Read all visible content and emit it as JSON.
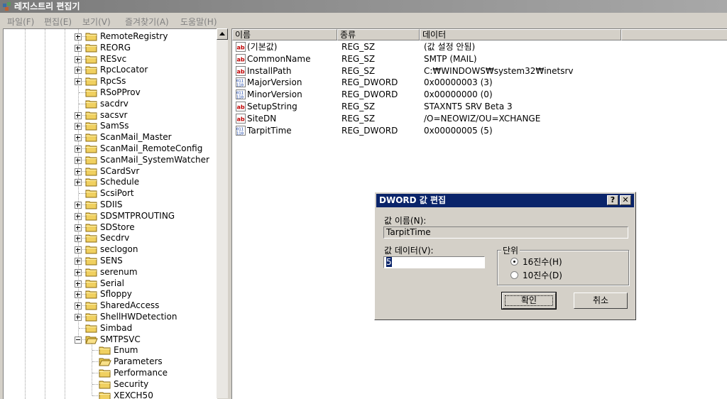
{
  "window": {
    "title": "레지스트리 편집기"
  },
  "menu": [
    {
      "label": "파일(F)"
    },
    {
      "label": "편집(E)"
    },
    {
      "label": "보기(V)"
    },
    {
      "label": "즐겨찾기(A)"
    },
    {
      "label": "도움말(H)"
    }
  ],
  "tree": {
    "items": [
      {
        "label": "RemoteRegistry",
        "expandable": true,
        "level": 0
      },
      {
        "label": "REORG",
        "expandable": true,
        "level": 0
      },
      {
        "label": "RESvc",
        "expandable": true,
        "level": 0
      },
      {
        "label": "RpcLocator",
        "expandable": true,
        "level": 0
      },
      {
        "label": "RpcSs",
        "expandable": true,
        "level": 0
      },
      {
        "label": "RSoPProv",
        "expandable": false,
        "level": 0
      },
      {
        "label": "sacdrv",
        "expandable": false,
        "level": 0
      },
      {
        "label": "sacsvr",
        "expandable": true,
        "level": 0
      },
      {
        "label": "SamSs",
        "expandable": true,
        "level": 0
      },
      {
        "label": "ScanMail_Master",
        "expandable": true,
        "level": 0
      },
      {
        "label": "ScanMail_RemoteConfig",
        "expandable": true,
        "level": 0
      },
      {
        "label": "ScanMail_SystemWatcher",
        "expandable": true,
        "level": 0
      },
      {
        "label": "SCardSvr",
        "expandable": true,
        "level": 0
      },
      {
        "label": "Schedule",
        "expandable": true,
        "level": 0
      },
      {
        "label": "ScsiPort",
        "expandable": false,
        "level": 0
      },
      {
        "label": "SDIIS",
        "expandable": true,
        "level": 0
      },
      {
        "label": "SDSMTPROUTING",
        "expandable": true,
        "level": 0
      },
      {
        "label": "SDStore",
        "expandable": true,
        "level": 0
      },
      {
        "label": "Secdrv",
        "expandable": true,
        "level": 0
      },
      {
        "label": "seclogon",
        "expandable": true,
        "level": 0
      },
      {
        "label": "SENS",
        "expandable": true,
        "level": 0
      },
      {
        "label": "serenum",
        "expandable": true,
        "level": 0
      },
      {
        "label": "Serial",
        "expandable": true,
        "level": 0
      },
      {
        "label": "Sfloppy",
        "expandable": true,
        "level": 0
      },
      {
        "label": "SharedAccess",
        "expandable": true,
        "level": 0
      },
      {
        "label": "ShellHWDetection",
        "expandable": true,
        "level": 0
      },
      {
        "label": "Simbad",
        "expandable": false,
        "level": 0
      },
      {
        "label": "SMTPSVC",
        "expandable": true,
        "expanded": true,
        "level": 0
      },
      {
        "label": "Enum",
        "expandable": false,
        "level": 1
      },
      {
        "label": "Parameters",
        "expandable": false,
        "level": 1,
        "open": true
      },
      {
        "label": "Performance",
        "expandable": false,
        "level": 1
      },
      {
        "label": "Security",
        "expandable": false,
        "level": 1
      },
      {
        "label": "XEXCH50",
        "expandable": false,
        "level": 1
      }
    ]
  },
  "list": {
    "columns": [
      "이름",
      "종류",
      "데이터"
    ],
    "rows": [
      {
        "name": "(기본값)",
        "type": "REG_SZ",
        "data": "(값 설정 안됨)",
        "icon": "string-value-icon"
      },
      {
        "name": "CommonName",
        "type": "REG_SZ",
        "data": "SMTP (MAIL)",
        "icon": "string-value-icon"
      },
      {
        "name": "InstallPath",
        "type": "REG_SZ",
        "data": "C:₩WINDOWS₩system32₩inetsrv",
        "icon": "string-value-icon"
      },
      {
        "name": "MajorVersion",
        "type": "REG_DWORD",
        "data": "0x00000003 (3)",
        "icon": "binary-value-icon"
      },
      {
        "name": "MinorVersion",
        "type": "REG_DWORD",
        "data": "0x00000000 (0)",
        "icon": "binary-value-icon"
      },
      {
        "name": "SetupString",
        "type": "REG_SZ",
        "data": "STAXNT5 SRV Beta 3",
        "icon": "string-value-icon"
      },
      {
        "name": "SiteDN",
        "type": "REG_SZ",
        "data": "/O=NEOWIZ/OU=XCHANGE",
        "icon": "string-value-icon"
      },
      {
        "name": "TarpitTime",
        "type": "REG_DWORD",
        "data": "0x00000005 (5)",
        "icon": "binary-value-icon"
      }
    ]
  },
  "dialog": {
    "title": "DWORD 값 편집",
    "help_button": "?",
    "close_button": "✕",
    "value_name_label": "값 이름(N):",
    "value_name": "TarpitTime",
    "value_data_label": "값 데이터(V):",
    "value_data": "5",
    "base_group_label": "단위",
    "base_hex_label": "16진수(H)",
    "base_dec_label": "10진수(D)",
    "base_selected": "hex",
    "ok_label": "확인",
    "cancel_label": "취소"
  },
  "colors": {
    "dialog_title_bg": "#0a246a",
    "window_title_bg": "#8a8a8a",
    "face": "#d4d0c8"
  }
}
